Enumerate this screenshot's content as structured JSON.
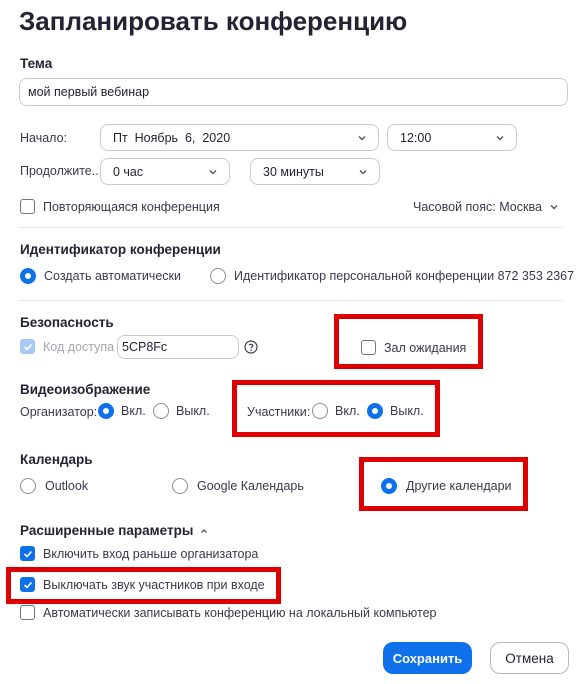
{
  "window": {
    "title": "Запланировать конференцию"
  },
  "topic": {
    "label": "Тема",
    "value": "мой первый вебинар"
  },
  "start": {
    "label": "Начало:",
    "date": "Пт  Ноябрь  6,  2020",
    "time": "12:00"
  },
  "duration": {
    "label": "Продолжите...",
    "hours": "0 час",
    "minutes": "30 минуты"
  },
  "recurring": {
    "label": "Повторяющаяся конференция",
    "checked": false
  },
  "timezone": {
    "value": "Часовой пояс: Москва"
  },
  "meeting_id": {
    "section": "Идентификатор конференции",
    "auto_label": "Создать автоматически",
    "personal_label": "Идентификатор персональной конференции 872 353 2367",
    "selected": "auto"
  },
  "security": {
    "section": "Безопасность",
    "passcode_label": "Код доступа",
    "passcode_value": "5CP8Fc",
    "help_icon": "question-circle-icon",
    "waiting_room_label": "Зал ожидания",
    "waiting_room_checked": false
  },
  "video": {
    "section": "Видеоизображение",
    "host_label": "Организатор:",
    "host_on": "Вкл.",
    "host_off": "Выкл.",
    "host_selected": "on",
    "participants_label": "Участники:",
    "participants_on": "Вкл.",
    "participants_off": "Выкл.",
    "participants_selected": "off"
  },
  "calendar": {
    "section": "Календарь",
    "options": [
      "Outlook",
      "Google Календарь",
      "Другие календари"
    ],
    "selected": "Другие календари"
  },
  "advanced": {
    "section": "Расширенные параметры",
    "options": [
      {
        "label": "Включить вход раньше организатора",
        "checked": true
      },
      {
        "label": "Выключать звук участников при входе",
        "checked": true
      },
      {
        "label": "Автоматически записывать конференцию на локальный компьютер",
        "checked": false
      }
    ]
  },
  "buttons": {
    "save": "Сохранить",
    "cancel": "Отмена"
  },
  "colors": {
    "accent": "#0e71eb",
    "highlight": "#dd0000",
    "text": "#232333"
  }
}
